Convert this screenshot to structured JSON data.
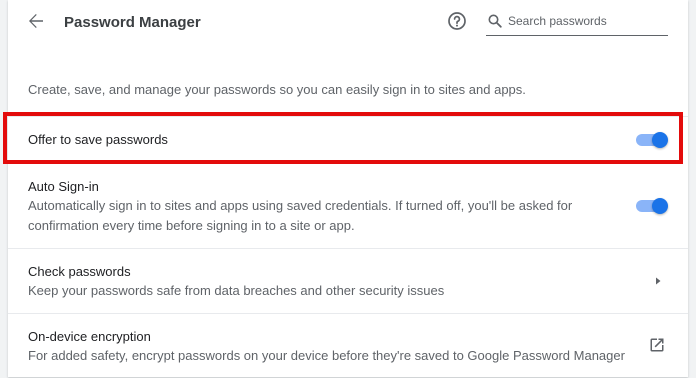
{
  "header": {
    "title": "Password Manager",
    "back_icon": "arrow-back-icon",
    "help_icon": "help-circle-icon",
    "search": {
      "placeholder": "Search passwords",
      "value": ""
    }
  },
  "intro_text": "Create, save, and manage your passwords so you can easily sign in to sites and apps.",
  "settings": {
    "offer_to_save": {
      "label": "Offer to save passwords",
      "enabled": true
    },
    "auto_sign_in": {
      "label": "Auto Sign-in",
      "description_line1": "Automatically sign in to sites and apps using saved credentials. If turned off, you'll be asked for",
      "description_line2": "confirmation every time before signing in to a site or app.",
      "enabled": true
    },
    "check_passwords": {
      "label": "Check passwords",
      "description": "Keep your passwords safe from data breaches and other security issues",
      "icon": "chevron-right-icon"
    },
    "on_device_encryption": {
      "label": "On-device encryption",
      "description": "For added safety, encrypt passwords on your device before they're saved to Google Password Manager",
      "icon": "open-in-new-icon"
    }
  },
  "colors": {
    "toggle_knob": "#1a73e8",
    "toggle_track": "#8ab4f8",
    "highlight_border": "#e30b0b"
  }
}
